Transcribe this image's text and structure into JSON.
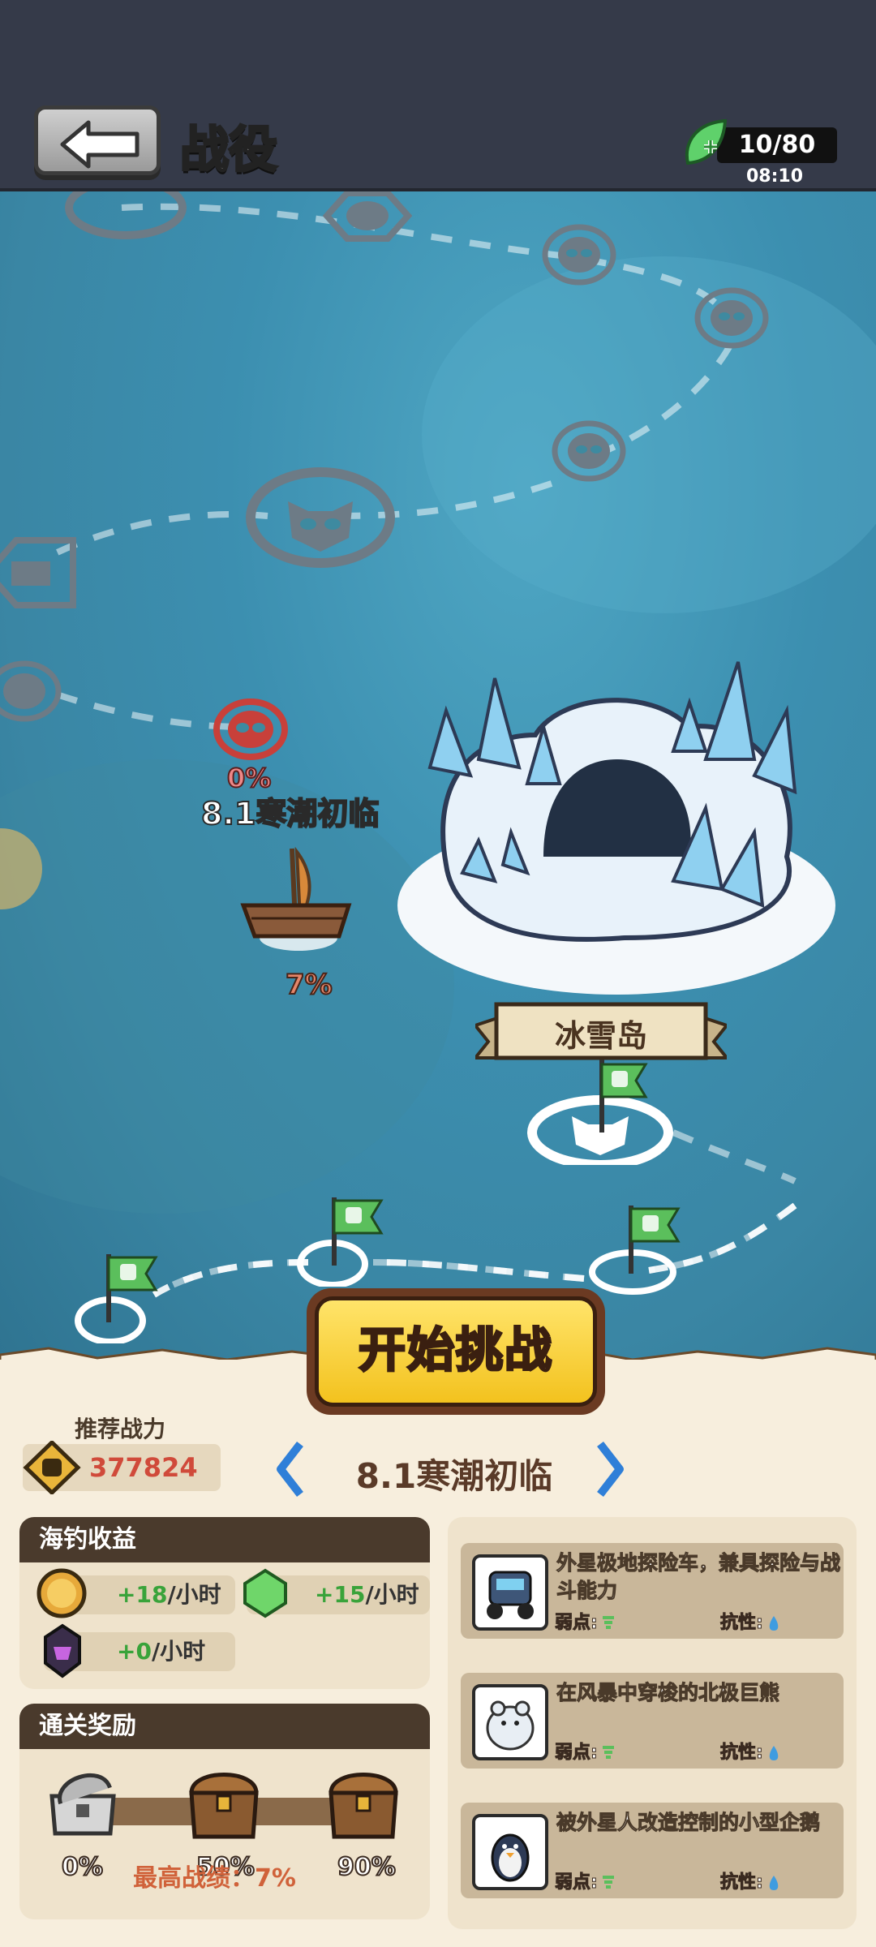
{
  "header": {
    "title": "战役",
    "energy": "10/80",
    "energy_timer": "08:10"
  },
  "map": {
    "current_stage_label": "8.1寒潮初临",
    "current_stage_progress": "0%",
    "boat_progress": "7%",
    "island_name": "冰雪岛"
  },
  "actions": {
    "start_label": "开始挑战"
  },
  "stage_info": {
    "recommended_label": "推荐战力",
    "recommended_power": "377824",
    "stage_name": "8.1寒潮初临"
  },
  "fishing": {
    "title": "海钓收益",
    "items": [
      {
        "icon": "coin-icon",
        "value": "+18",
        "unit": "/小时"
      },
      {
        "icon": "exp-gem-icon",
        "value": "+15",
        "unit": "/小时"
      },
      {
        "icon": "dark-crystal-icon",
        "value": "+0",
        "unit": "/小时"
      }
    ]
  },
  "rewards": {
    "title": "通关奖励",
    "chests": [
      {
        "label": "0%",
        "state": "opened"
      },
      {
        "label": "50%",
        "state": "closed"
      },
      {
        "label": "90%",
        "state": "closed"
      }
    ],
    "best_record": "最高战绩：7%"
  },
  "enemies": [
    {
      "desc": "外星极地探险车，兼具探险与战斗能力",
      "weak_label": "弱点:",
      "res_label": "抗性:"
    },
    {
      "desc": "在风暴中穿梭的北极巨熊",
      "weak_label": "弱点:",
      "res_label": "抗性:"
    },
    {
      "desc": "被外星人改造控制的小型企鹅",
      "weak_label": "弱点:",
      "res_label": "抗性:"
    }
  ],
  "colors": {
    "top_bar": "#353a49",
    "sea": "#3c8fb0",
    "panel": "#f7eedd",
    "start_button": "#f3c21e",
    "power_value": "#d04a3a",
    "income_value": "#39a33a"
  }
}
